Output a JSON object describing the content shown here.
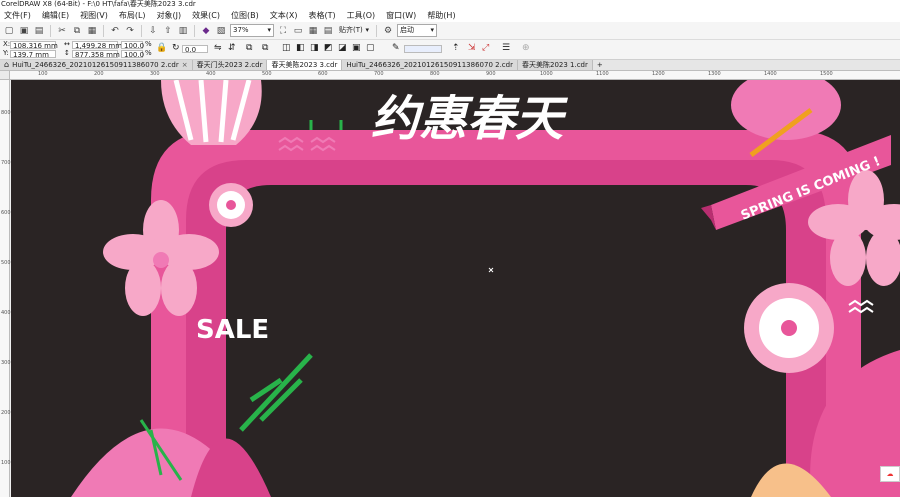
{
  "window": {
    "title": "CorelDRAW X8 (64-Bit) - F:\\0 HT\\fafa\\春天美陈2023 3.cdr"
  },
  "menu": [
    "文件(F)",
    "编辑(E)",
    "视图(V)",
    "布局(L)",
    "对象(J)",
    "效果(C)",
    "位图(B)",
    "文本(X)",
    "表格(T)",
    "工具(O)",
    "窗口(W)",
    "帮助(H)"
  ],
  "toolbar": {
    "zoom": "37%",
    "snap_label": "贴齐(T)",
    "launch_label": "启动"
  },
  "property_bar": {
    "x_label": "X:",
    "x_value": "108.316 mm",
    "y_label": "Y:",
    "y_value": "139.7 mm",
    "w_value": "1,499.28 mm",
    "h_value": "877.358 mm",
    "scale_x": "100.0",
    "scale_y": "100.0",
    "scale_unit": "%",
    "angle": "0.0"
  },
  "tabs": [
    {
      "label": "HuiTu_2466326_20210126150911386070 2.cdr",
      "active": false
    },
    {
      "label": "春天门头2023 2.cdr",
      "active": false
    },
    {
      "label": "春天美陈2023 3.cdr",
      "active": true
    },
    {
      "label": "HuiTu_2466326_20210126150911386070 2.cdr",
      "active": false
    },
    {
      "label": "春天美陈2023 1.cdr",
      "active": false
    }
  ],
  "ruler": {
    "h_ticks": [
      "100",
      "200",
      "300",
      "400",
      "500",
      "600",
      "700",
      "800",
      "900",
      "1000",
      "1100",
      "1200",
      "1300",
      "1400",
      "1500"
    ],
    "v_ticks": [
      "800",
      "700",
      "600",
      "500",
      "400",
      "300",
      "200",
      "100"
    ]
  },
  "artwork": {
    "headline": "约惠春天",
    "banner": "SPRING IS COMING !",
    "sale": "SALE"
  },
  "colors": {
    "canvas_bg": "#2a2424",
    "arch_pink": "#e8569a",
    "arch_light": "#f07ab5",
    "petal": "#f7a8c8",
    "leaf_green": "#28b34a"
  }
}
